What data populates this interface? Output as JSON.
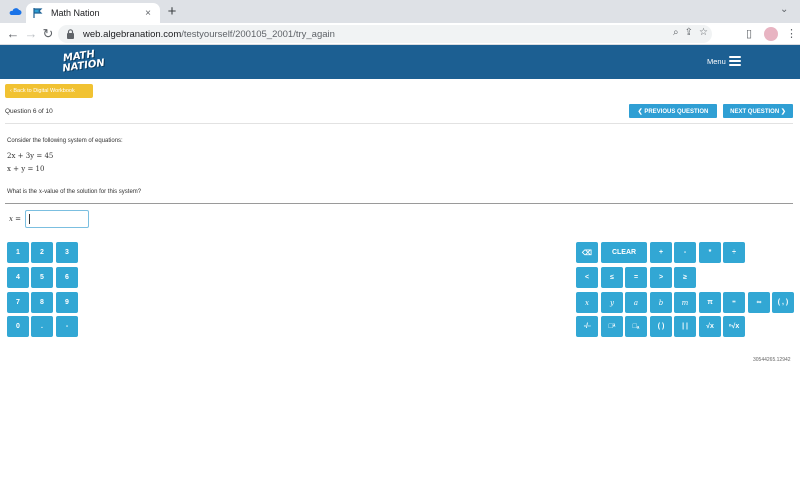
{
  "browser": {
    "tab_title": "Math Nation",
    "url_host": "web.algebranation.com",
    "url_path": "/testyourself/200105_2001/try_again",
    "tab_close": "×",
    "new_tab": "+"
  },
  "header": {
    "logo_line1": "MATH",
    "logo_line2": "NATION",
    "menu_label": "Menu"
  },
  "page": {
    "back_label": "‹ Back to Digital Workbook",
    "question_count": "Question 6 of 10",
    "prev_label": "❮ PREVIOUS QUESTION",
    "next_label": "NEXT QUESTION ❯",
    "intro": "Consider the following system of equations:",
    "equation1": "2x + 3y = 45",
    "equation2": "x + y = 10",
    "question_before": "What is the ",
    "question_var": "x",
    "question_after": "-value of the solution for this system?",
    "answer_label": "x =",
    "answer_value": "",
    "footer_id": "30544265.12942"
  },
  "keypad_numeric": [
    [
      "1",
      "2",
      "3"
    ],
    [
      "4",
      "5",
      "6"
    ],
    [
      "7",
      "8",
      "9"
    ],
    [
      "0",
      ".",
      "-"
    ]
  ],
  "keypad_symbols": {
    "row1": [
      "⌫",
      "CLEAR",
      "+",
      "-",
      "*",
      "÷"
    ],
    "row2": [
      "<",
      "≤",
      "=",
      ">",
      "≥"
    ],
    "row3": [
      "x",
      "y",
      "a",
      "b",
      "m",
      "π",
      "⁼",
      "∞",
      "( , )"
    ],
    "row4": [
      "▫/▫",
      "□ᵃ",
      "□ₐ",
      "( )",
      "| |",
      "√x",
      "ⁿ√x"
    ]
  }
}
